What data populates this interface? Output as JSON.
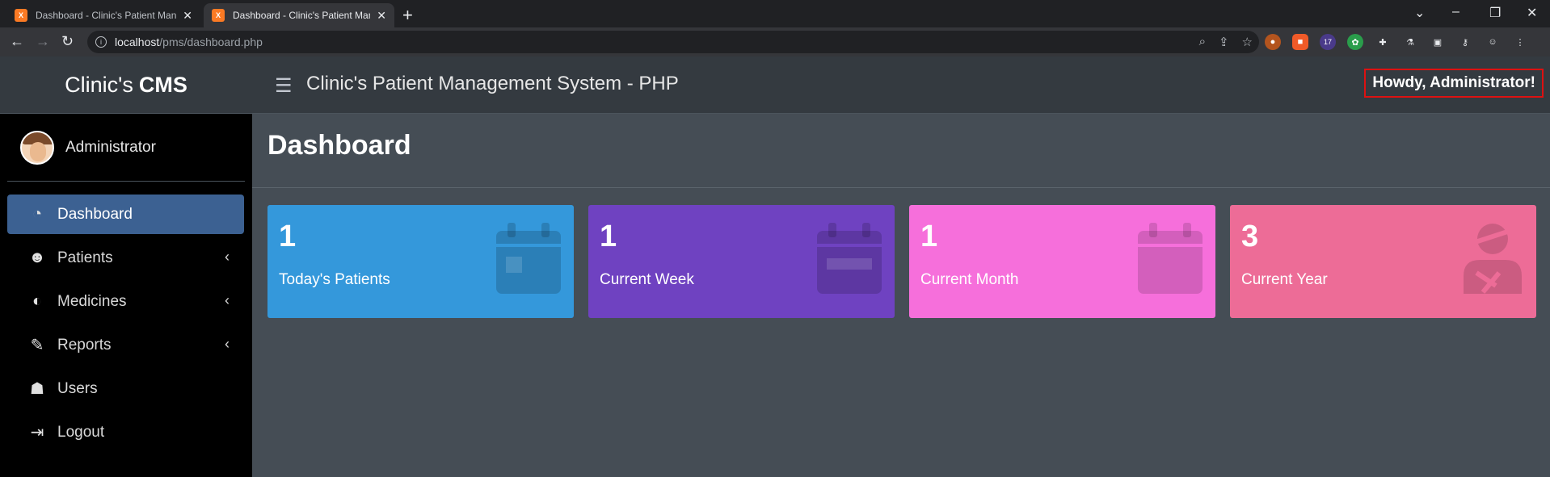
{
  "browser": {
    "tabs": [
      {
        "title": "Dashboard - Clinic's Patient Management System",
        "close": "✕"
      },
      {
        "title": "Dashboard - Clinic's Patient Management System",
        "close": "✕"
      }
    ],
    "new_tab": "+",
    "url_host": "localhost",
    "url_path": "/pms/dashboard.php",
    "extension_badge": "17"
  },
  "sidebar": {
    "brand_prefix": "Clinic's",
    "brand_bold": "CMS",
    "user_name": "Administrator",
    "items": [
      {
        "label": "Dashboard",
        "icon": "tachometer-icon",
        "glyph": "◔",
        "active": true
      },
      {
        "label": "Patients",
        "icon": "user-injured-icon",
        "glyph": "☻",
        "chevron": "‹"
      },
      {
        "label": "Medicines",
        "icon": "pills-icon",
        "glyph": "◐",
        "chevron": "‹"
      },
      {
        "label": "Reports",
        "icon": "edit-icon",
        "glyph": "✎",
        "chevron": "‹"
      },
      {
        "label": "Users",
        "icon": "users-icon",
        "glyph": "☗"
      },
      {
        "label": "Logout",
        "icon": "sign-out-icon",
        "glyph": "⇥"
      }
    ]
  },
  "header": {
    "title": "Clinic's Patient Management System - PHP",
    "greeting": "Howdy, Administrator!"
  },
  "main": {
    "page_title": "Dashboard",
    "cards": [
      {
        "value": "1",
        "label": "Today's Patients",
        "color": "#3498db",
        "icon": "calendar-day-icon"
      },
      {
        "value": "1",
        "label": "Current Week",
        "color": "#6f42c1",
        "icon": "calendar-week-icon"
      },
      {
        "value": "1",
        "label": "Current Month",
        "color": "#f66fdb",
        "icon": "calendar-icon"
      },
      {
        "value": "3",
        "label": "Current Year",
        "color": "#ed6c97",
        "icon": "user-injured-icon"
      }
    ]
  },
  "colors": {
    "sidebar_bg": "#000000",
    "header_bg": "#343a40",
    "content_bg": "#454d55",
    "active_item": "#3c6192",
    "highlight_border": "#dd1111"
  }
}
